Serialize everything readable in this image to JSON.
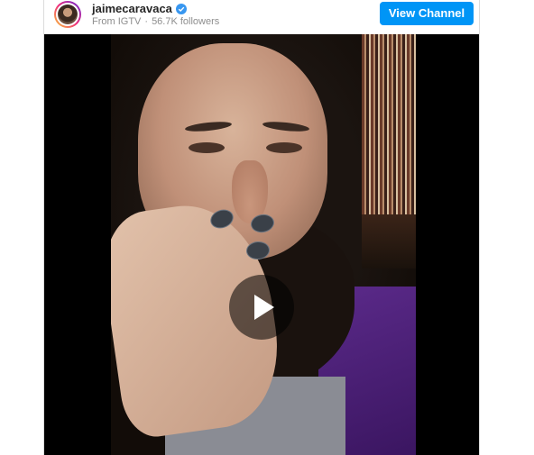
{
  "header": {
    "username": "jaimecaravaca",
    "verified": true,
    "source": "From IGTV",
    "separator": "·",
    "followers": "56.7K followers",
    "view_channel_label": "View Channel"
  },
  "colors": {
    "accent": "#0095f6",
    "username": "#262626",
    "muted": "#8e8e8e",
    "video_bg": "#000000"
  },
  "video": {
    "play_icon": "play-icon"
  }
}
